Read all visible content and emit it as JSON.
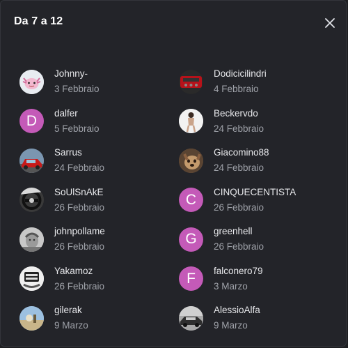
{
  "dialog": {
    "title": "Da 7 a 12",
    "close_icon": "close-icon"
  },
  "colors": {
    "background": "#232429",
    "name_text": "#e8e9ec",
    "date_text": "#9ea1a8",
    "letter_avatar": "#c45ab8"
  },
  "members": [
    {
      "name": "Johnny-",
      "date": "3 Febbraio",
      "avatar": "axolotl-photo"
    },
    {
      "name": "Dodicicilindri",
      "date": "4 Febbraio",
      "avatar": "engine-photo"
    },
    {
      "name": "dalfer",
      "date": "5 Febbraio",
      "avatar_letter": "D"
    },
    {
      "name": "Beckervdo",
      "date": "24 Febbraio",
      "avatar": "person-photo"
    },
    {
      "name": "Sarrus",
      "date": "24 Febbraio",
      "avatar": "red-car-photo"
    },
    {
      "name": "Giacomino88",
      "date": "24 Febbraio",
      "avatar": "dog-photo"
    },
    {
      "name": "SoUlSnAkE",
      "date": "26 Febbraio",
      "avatar": "steering-wheel-photo"
    },
    {
      "name": "CINQUECENTISTA",
      "date": "26 Febbraio",
      "avatar_letter": "C"
    },
    {
      "name": "johnpollame",
      "date": "26 Febbraio",
      "avatar": "bw-photo"
    },
    {
      "name": "greenhell",
      "date": "26 Febbraio",
      "avatar_letter": "G"
    },
    {
      "name": "Yakamoz",
      "date": "26 Febbraio",
      "avatar": "logo-badge-photo"
    },
    {
      "name": "falconero79",
      "date": "3 Marzo",
      "avatar_letter": "F"
    },
    {
      "name": "gilerak",
      "date": "9 Marzo",
      "avatar": "landscape-photo"
    },
    {
      "name": "AlessioAlfa",
      "date": "9 Marzo",
      "avatar": "street-photo"
    }
  ]
}
